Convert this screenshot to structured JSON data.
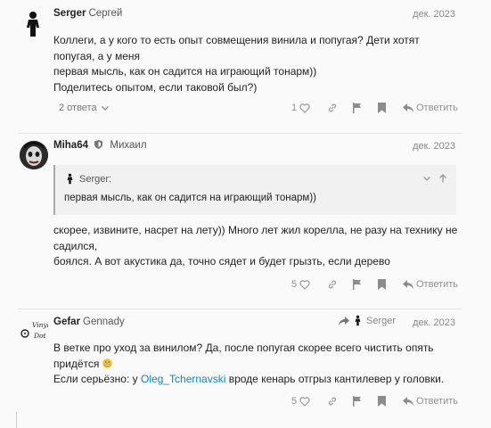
{
  "posts": [
    {
      "username": "Serger",
      "fullname": "Сергей",
      "date": "дек. 2023",
      "lines": [
        "Коллеги, а у кого то есть опыт совмещения винила и попугая? Дети хотят попугая, а у меня",
        "первая мысль, как он садится на играющий тонарм))",
        "Поделитесь опытом, если таковой был?)"
      ],
      "replies_label": "2 ответа",
      "likes": "1",
      "reply_label": "Ответить"
    },
    {
      "username": "Miha64",
      "fullname": "Михаил",
      "date": "дек. 2023",
      "quote": {
        "author": "Serger:",
        "text": "первая мысль, как он садится на играющий тонарм))"
      },
      "lines": [
        "скорее, извините, насрет на лету)) Много лет жил корелла, не разу на технику не садился,",
        "боялся. А вот акустика да, точно сядет и будет грызть, если дерево"
      ],
      "likes": "5",
      "reply_label": "Ответить"
    },
    {
      "username": "Gefar",
      "fullname": "Gennady",
      "date": "дек. 2023",
      "reply_to": "Serger",
      "avatar_text": [
        "Vinyl",
        "Dot"
      ],
      "line1": "В ветке про уход за винилом? Да, после попугая скорее всего чистить опять придётся",
      "line2_before": "Если серьёзно: у ",
      "line2_mention": "Oleg_Tchernavski",
      "line2_after": " вроде кенарь отгрыз кантилевер у головки.",
      "likes": "5",
      "reply_label": "Ответить"
    }
  ]
}
